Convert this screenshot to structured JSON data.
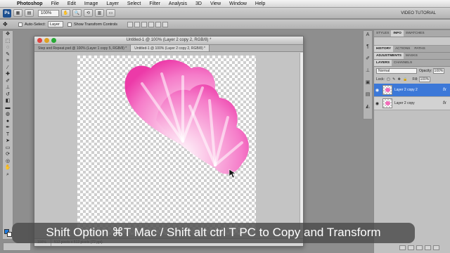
{
  "menubar": {
    "app_name": "Photoshop",
    "items": [
      "File",
      "Edit",
      "Image",
      "Layer",
      "Select",
      "Filter",
      "Analysis",
      "3D",
      "View",
      "Window",
      "Help"
    ]
  },
  "appbar": {
    "ps_label": "Ps",
    "zoom": "100%",
    "workspace": "VIDEO TUTORIAL"
  },
  "optionsbar": {
    "auto_select_label": "Auto-Select:",
    "auto_select_value": "Layer",
    "transform_controls_label": "Show Transform Controls"
  },
  "document": {
    "title": "Untitled-1 @ 100% (Layer 2 copy 2, RGB/8) *",
    "tabs": [
      "Step and Repeat.psd @ 100% (Layer 1 copy 5, RGB/8) *",
      "Untitled-1 @ 100% (Layer 2 copy 2, RGB/8) *"
    ],
    "zoom": "100%",
    "status": "512 pixels x 512 pixels (72 ppi)"
  },
  "panels": {
    "top_tabs": [
      "STYLES",
      "INFO",
      "SWATCHES"
    ],
    "history_tabs": [
      "HISTORY",
      "ACTIONS",
      "PATHS"
    ],
    "adjust_tabs": [
      "ADJUSTMENTS",
      "MASKS"
    ],
    "layer_tabs": [
      "LAYERS",
      "CHANNELS"
    ],
    "blend_mode": "Normal",
    "opacity_label": "Opacity:",
    "opacity": "100%",
    "lock_label": "Lock:",
    "fill_label": "Fill:",
    "fill": "100%",
    "layers": [
      {
        "name": "Layer 2 copy 2",
        "selected": true,
        "fx": "fx"
      },
      {
        "name": "Layer 2 copy",
        "selected": false,
        "fx": "fx"
      }
    ]
  },
  "caption": "Shift Option ⌘T Mac / Shift alt ctrl T PC to Copy and Transform",
  "colors": {
    "petal_pink": "#f251b4",
    "selection_blue": "#3c78d8",
    "foreground_color": "#1e7be0"
  }
}
